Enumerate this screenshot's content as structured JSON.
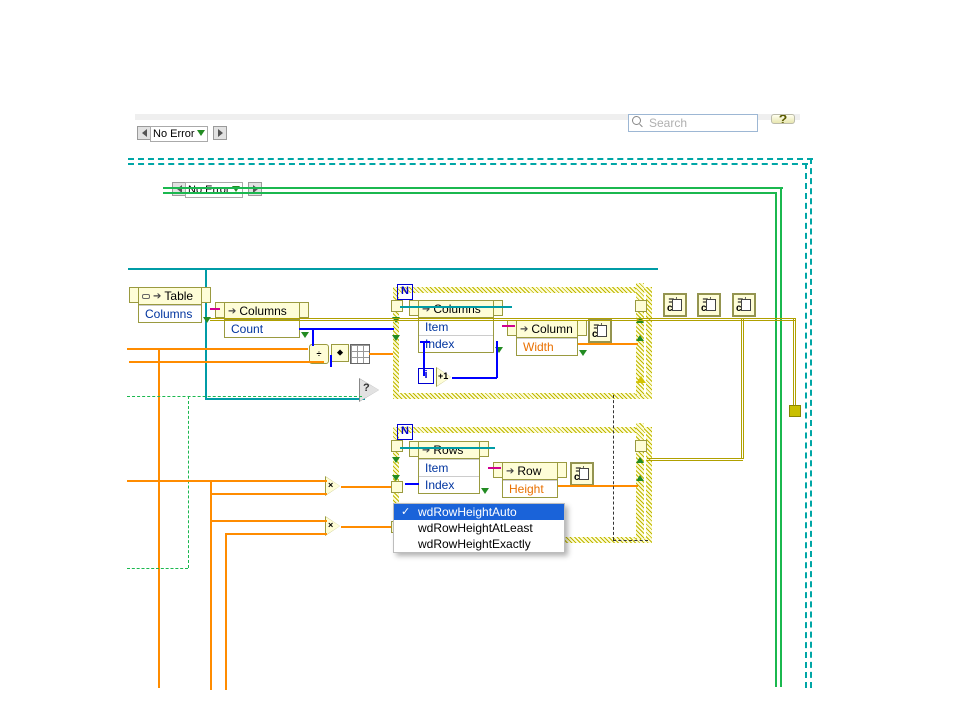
{
  "toolbar": {
    "search_placeholder": "Search"
  },
  "cases": {
    "outer": "No Error",
    "inner": "No Error"
  },
  "loops": {
    "n": "N",
    "i": "i"
  },
  "nodes": {
    "table": {
      "title": "Table",
      "prop": "Columns"
    },
    "columns": {
      "title": "Columns",
      "prop": "Count"
    },
    "columns_loop": {
      "title": "Columns",
      "prop1": "Item",
      "prop2": "Index"
    },
    "column": {
      "title": "Column",
      "prop": "Width"
    },
    "rows": {
      "title": "Rows",
      "prop1": "Item",
      "prop2": "Index"
    },
    "row": {
      "title": "Row",
      "prop": "Height"
    }
  },
  "menu": {
    "items": [
      "wdRowHeightAuto",
      "wdRowHeightAtLeast",
      "wdRowHeightExactly"
    ],
    "selected_index": 0
  }
}
